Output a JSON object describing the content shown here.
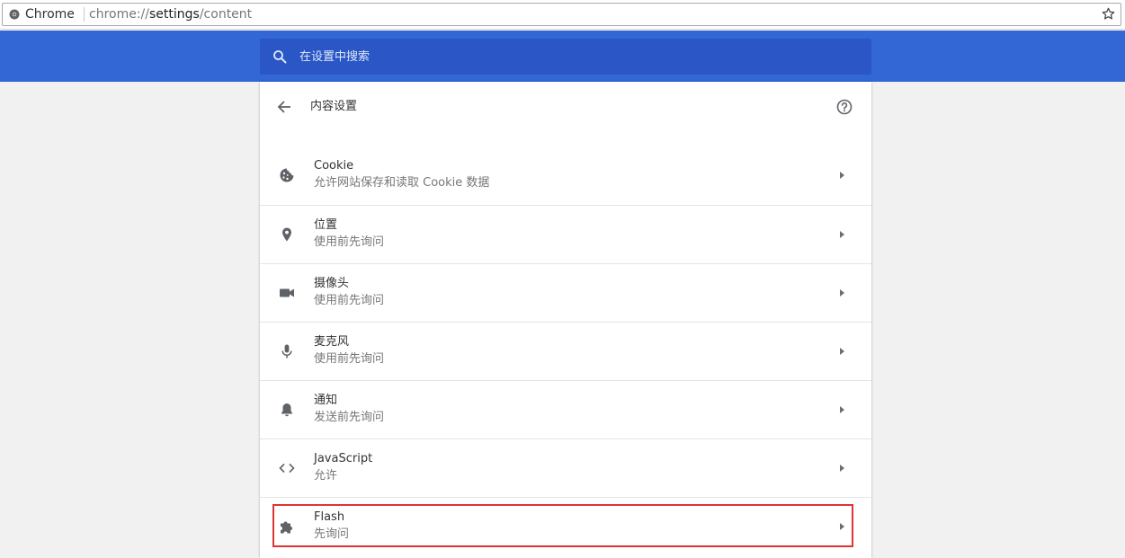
{
  "browser": {
    "chip_label": "Chrome",
    "url_scheme": "chrome://",
    "url_host": "settings",
    "url_path": "/content",
    "icons": {
      "site": "chrome-logo-icon",
      "bookmark": "star-icon"
    }
  },
  "search": {
    "placeholder": "在设置中搜索",
    "icon": "search-icon"
  },
  "page": {
    "title": "内容设置",
    "back_icon": "arrow-back-icon",
    "help_icon": "help-circle-icon"
  },
  "settings": [
    {
      "label": "Cookie",
      "sub": "允许网站保存和读取 Cookie 数据",
      "icon": "cookie-icon"
    },
    {
      "label": "位置",
      "sub": "使用前先询问",
      "icon": "location-pin-icon"
    },
    {
      "label": "摄像头",
      "sub": "使用前先询问",
      "icon": "camera-icon"
    },
    {
      "label": "麦克风",
      "sub": "使用前先询问",
      "icon": "microphone-icon"
    },
    {
      "label": "通知",
      "sub": "发送前先询问",
      "icon": "bell-icon"
    },
    {
      "label": "JavaScript",
      "sub": "允许",
      "icon": "code-icon"
    },
    {
      "label": "Flash",
      "sub": "先询问",
      "icon": "puzzle-icon"
    }
  ],
  "colors": {
    "header_blue": "#3367d6",
    "search_blue": "#2a56c6",
    "highlight_red": "#e03333",
    "page_bg": "#f1f1f1"
  }
}
